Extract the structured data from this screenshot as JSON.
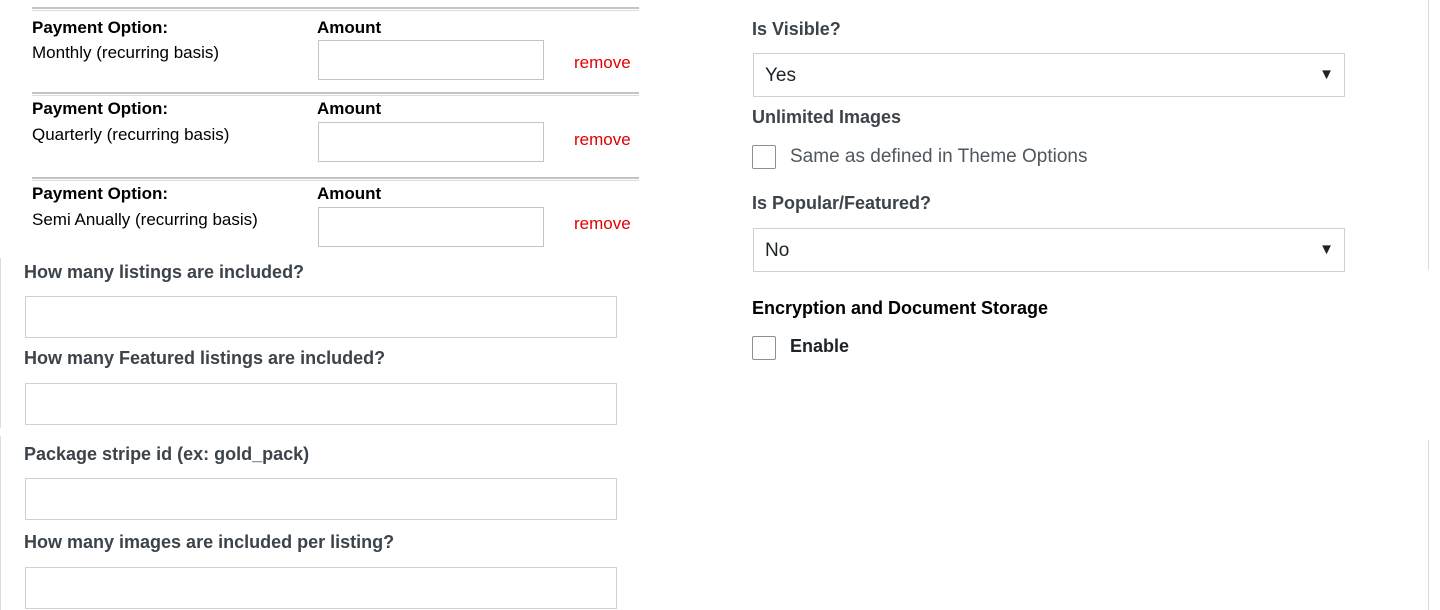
{
  "payment_options": [
    {
      "label": "Payment Option:",
      "value": "Monthly (recurring basis)",
      "amount_label": "Amount",
      "amount": "",
      "remove_label": "remove"
    },
    {
      "label": "Payment Option:",
      "value": "Quarterly (recurring basis)",
      "amount_label": "Amount",
      "amount": "",
      "remove_label": "remove"
    },
    {
      "label": "Payment Option:",
      "value": "Semi Anually (recurring basis)",
      "amount_label": "Amount",
      "amount": "",
      "remove_label": "remove"
    }
  ],
  "fields": {
    "listings_included": {
      "label": "How many listings are included?",
      "value": ""
    },
    "featured_listings_included": {
      "label": "How many Featured listings are included?",
      "value": ""
    },
    "stripe_id": {
      "label": "Package stripe id (ex: gold_pack)",
      "value": ""
    },
    "images_per_listing": {
      "label": "How many images are included per listing?",
      "value": ""
    }
  },
  "right": {
    "is_visible": {
      "label": "Is Visible?",
      "value": "Yes"
    },
    "unlimited_images": {
      "label": "Unlimited Images",
      "checkbox_label": "Same as defined in Theme Options",
      "checked": false
    },
    "is_popular": {
      "label": "Is Popular/Featured?",
      "value": "No"
    },
    "encryption": {
      "label": "Encryption and Document Storage",
      "checkbox_label": "Enable",
      "checked": false
    }
  },
  "icons": {
    "dropdown": "triangle-down-icon"
  },
  "colors": {
    "remove": "#e00000",
    "border": "#c3c4c7",
    "label": "#3c434a"
  }
}
